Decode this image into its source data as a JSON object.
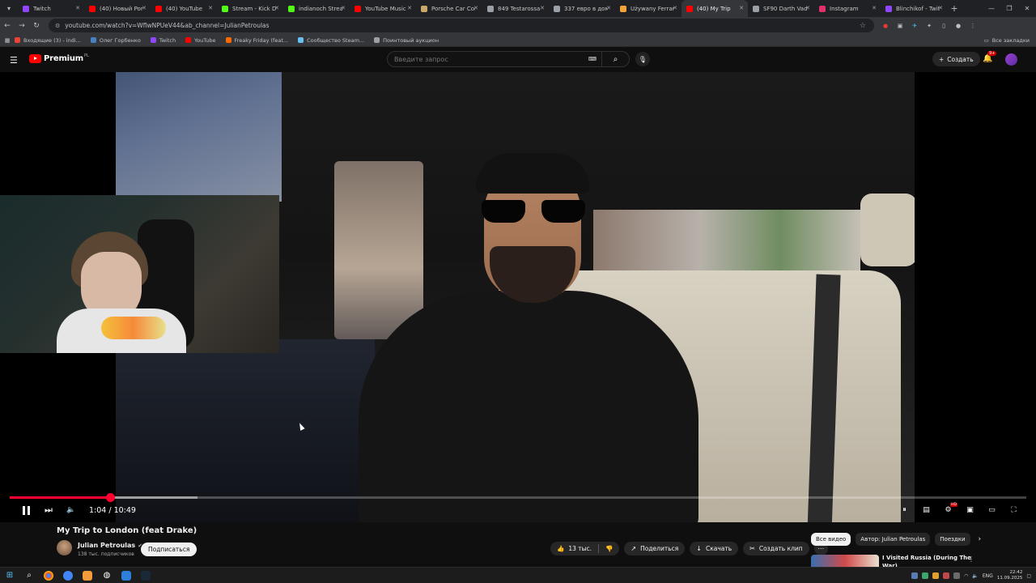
{
  "browser": {
    "tabs": [
      {
        "label": "Twitch",
        "color": "#9146ff",
        "active": false
      },
      {
        "label": "(40) Новый Porsche",
        "color": "#ff0000",
        "active": false
      },
      {
        "label": "(40) YouTube",
        "color": "#ff0000",
        "active": false
      },
      {
        "label": "Stream - Kick Da",
        "color": "#53fc18",
        "active": false
      },
      {
        "label": "indianoch Stream",
        "color": "#53fc18",
        "active": false
      },
      {
        "label": "YouTube Music",
        "color": "#ff0000",
        "active": false
      },
      {
        "label": "Porsche Car Conf",
        "color": "#c9a86a",
        "active": false
      },
      {
        "label": "849 Testarossa -",
        "color": "#9aa0a6",
        "active": false
      },
      {
        "label": "337 евро в доме",
        "color": "#9aa0a6",
        "active": false
      },
      {
        "label": "Używany Ferrari",
        "color": "#f2a33a",
        "active": false
      },
      {
        "label": "(40) My Trip",
        "color": "#ff0000",
        "active": true
      },
      {
        "label": "SF90 Darth Vade",
        "color": "#9aa0a6",
        "active": false
      },
      {
        "label": "Instagram",
        "color": "#e1306c",
        "active": false
      },
      {
        "label": "Blinchikof - Twitch",
        "color": "#9146ff",
        "active": false
      }
    ],
    "url": "youtube.com/watch?v=WflwNPUeV44&ab_channel=JulianPetroulas",
    "bookmarks": [
      {
        "label": "Входящие (3) - indi...",
        "color": "#ea4335"
      },
      {
        "label": "Олег Горбенко",
        "color": "#4680c2"
      },
      {
        "label": "Twitch",
        "color": "#9146ff"
      },
      {
        "label": "YouTube",
        "color": "#ff0000"
      },
      {
        "label": "Freaky Friday (feat...",
        "color": "#ff6a00"
      },
      {
        "label": "Сообщество Steam...",
        "color": "#66c0f4"
      },
      {
        "label": "Поинтовый аукцион",
        "color": "#9aa0a6"
      }
    ],
    "all_bookmarks": "Все закладки"
  },
  "youtube": {
    "logo_text": "Premium",
    "logo_region": "PL",
    "search_placeholder": "Введите запрос",
    "create_label": "Создать",
    "notifications_badge": "9+"
  },
  "player": {
    "current_time": "1:04",
    "duration": "10:49",
    "progress_fraction": 0.099,
    "buffered_fraction": 0.185
  },
  "video": {
    "title": "My Trip to London (feat Drake)",
    "channel": "Julian Petroulas",
    "subscribers": "138 тыс. подписчиков",
    "subscribe_label": "Подписаться",
    "likes": "13 тыс.",
    "share_label": "Поделиться",
    "download_label": "Скачать",
    "clip_label": "Создать клип"
  },
  "recommendations": {
    "chips": [
      "Все видео",
      "Автор: Julian Petroulas",
      "Поездки"
    ],
    "first_title": "I Visited Russia (During The",
    "first_title_line2": "War)"
  },
  "taskbar": {
    "lang": "ENG",
    "time": "22:42",
    "date": "11.09.2025"
  }
}
